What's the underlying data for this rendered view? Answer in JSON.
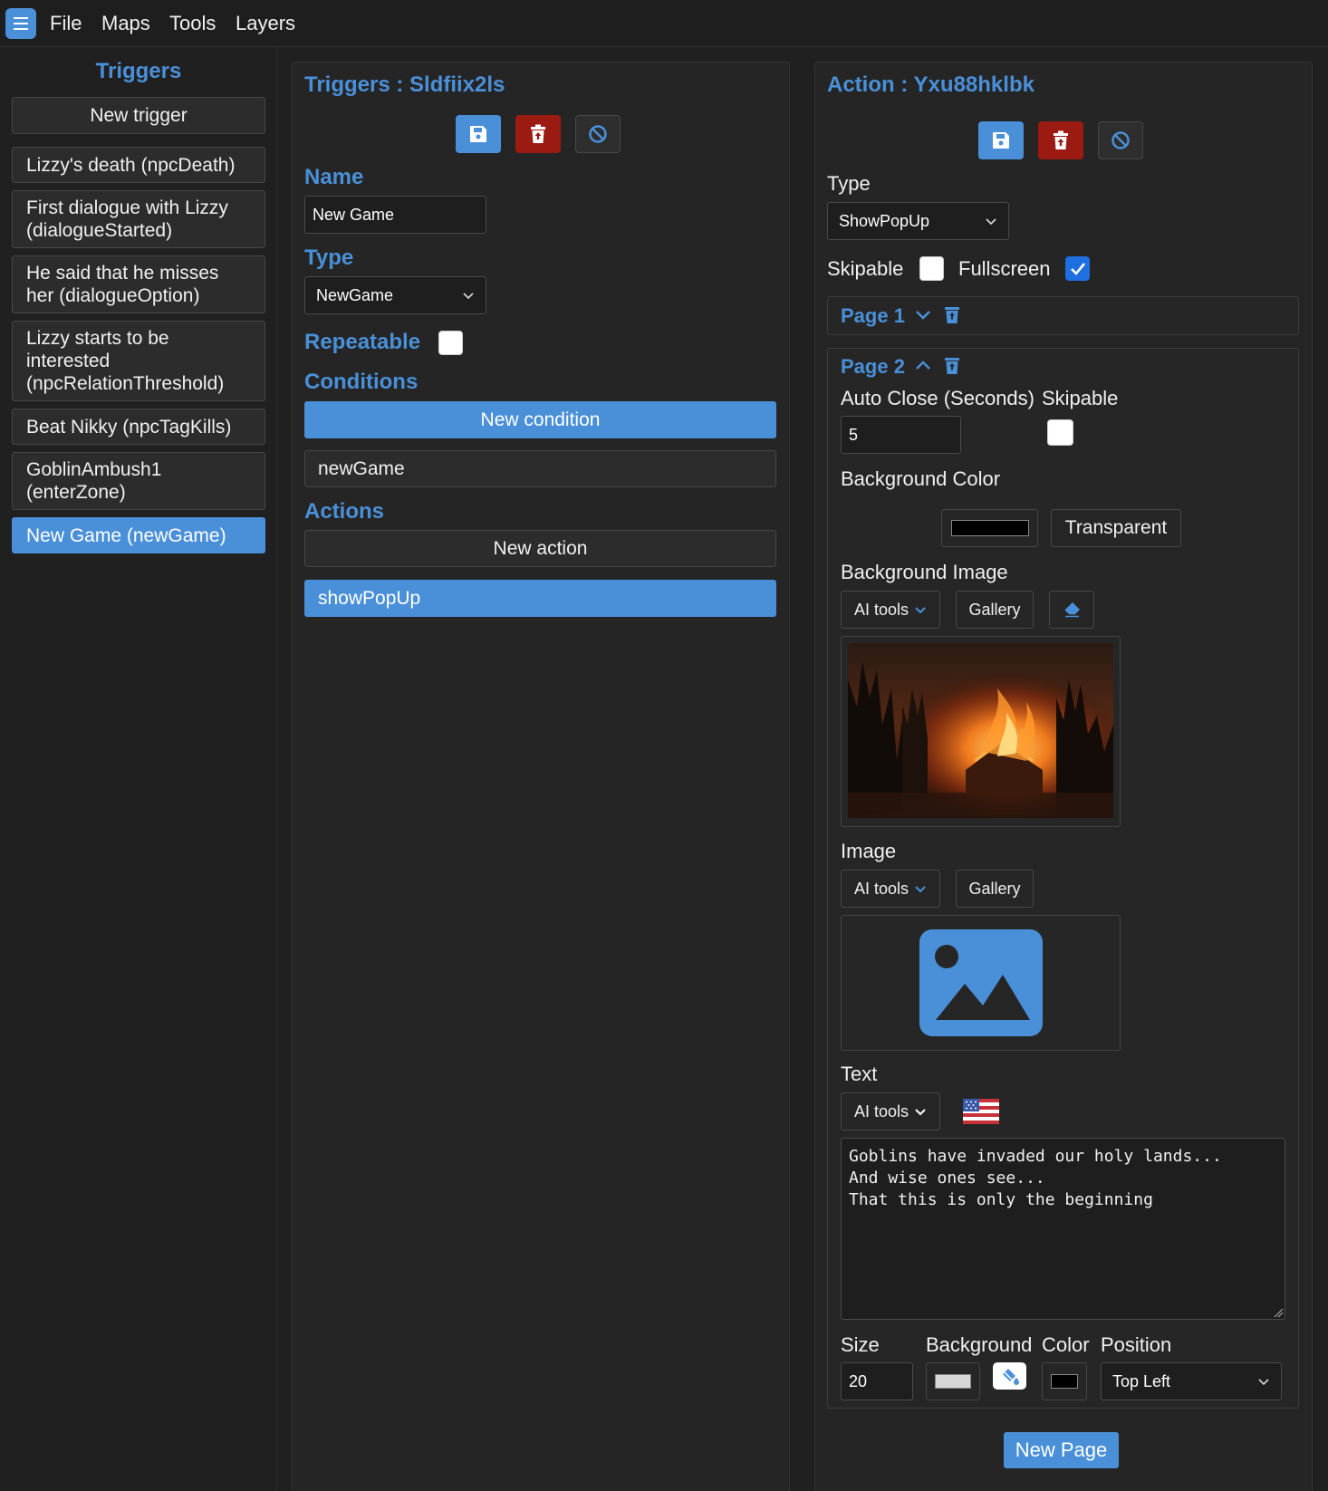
{
  "menubar": {
    "items": [
      "File",
      "Maps",
      "Tools",
      "Layers"
    ]
  },
  "left": {
    "title": "Triggers",
    "new_trigger_label": "New trigger",
    "triggers": [
      {
        "lines": [
          "Lizzy's death (npcDeath)"
        ]
      },
      {
        "lines": [
          "First dialogue with Lizzy",
          "(dialogueStarted)"
        ]
      },
      {
        "lines": [
          "He said that he misses",
          "her (dialogueOption)"
        ]
      },
      {
        "lines": [
          "Lizzy starts to be",
          "interested",
          "(npcRelationThreshold)"
        ]
      },
      {
        "lines": [
          "Beat Nikky (npcTagKills)"
        ]
      },
      {
        "lines": [
          "GoblinAmbush1",
          "(enterZone)"
        ]
      },
      {
        "lines": [
          "New Game (newGame)"
        ]
      }
    ]
  },
  "mid": {
    "title": "Triggers : Sldfiix2ls",
    "name_label": "Name",
    "name_value": "New Game",
    "type_label": "Type",
    "type_value": "NewGame",
    "repeatable_label": "Repeatable",
    "conditions_label": "Conditions",
    "new_condition_label": "New condition",
    "conditions": [
      "newGame"
    ],
    "actions_label": "Actions",
    "new_action_label": "New action",
    "actions": [
      "showPopUp"
    ]
  },
  "right": {
    "title": "Action : Yxu88hklbk",
    "type_label": "Type",
    "type_value": "ShowPopUp",
    "skipable_label": "Skipable",
    "fullscreen_label": "Fullscreen",
    "fullscreen_checked": true,
    "page1_label": "Page 1",
    "page2_label": "Page 2",
    "auto_close_label": "Auto Close (Seconds)",
    "auto_close_value": "5",
    "page_skipable_label": "Skipable",
    "bg_color_label": "Background Color",
    "bg_color_value": "#000000",
    "transparent_label": "Transparent",
    "bg_image_label": "Background Image",
    "ai_tools_label": "AI tools",
    "gallery_label": "Gallery",
    "image_label": "Image",
    "text_label": "Text",
    "text_value": "Goblins have invaded our holy lands...\nAnd wise ones see...\nThat this is only the beginning",
    "size_label": "Size",
    "size_value": "20",
    "background_label": "Background",
    "background_swatch": "#d8d8d8",
    "color_label": "Color",
    "color_swatch": "#000000",
    "position_label": "Position",
    "position_value": "Top Left",
    "new_page_label": "New Page"
  },
  "colors": {
    "accent": "#4a90d9",
    "danger": "#9b1b12",
    "bg": "#202020"
  }
}
